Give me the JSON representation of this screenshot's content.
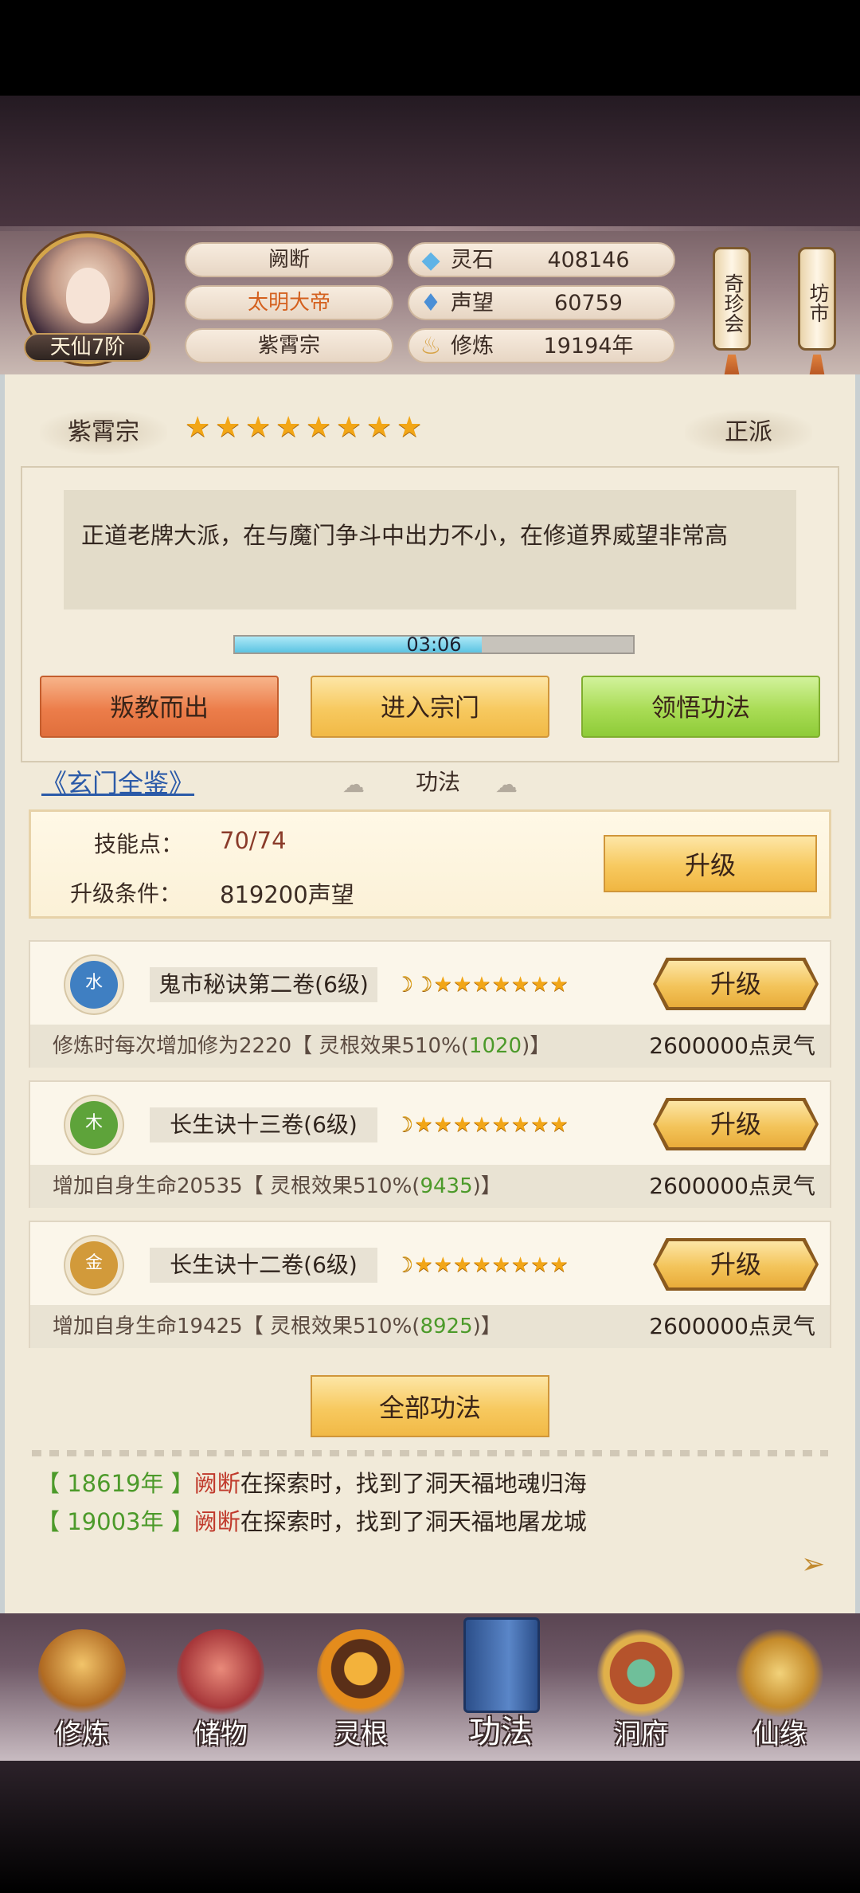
{
  "header": {
    "rank_badge": "天仙7阶",
    "player_name": "阙断",
    "title": "太明大帝",
    "sect": "紫霄宗",
    "stats": [
      {
        "icon": "spirit-stone-icon",
        "label": "灵石",
        "value": "408146"
      },
      {
        "icon": "reputation-icon",
        "label": "声望",
        "value": "60759"
      },
      {
        "icon": "cultivation-icon",
        "label": "修炼",
        "value": "19194年"
      }
    ],
    "side_buttons": [
      {
        "label": "奇珍会"
      },
      {
        "label": "坊市"
      }
    ]
  },
  "sect_panel": {
    "name": "紫霄宗",
    "stars": 8,
    "faction": "正派",
    "description": "正道老牌大派，在与魔门争斗中出力不小，在修道界威望非常高",
    "timer": "03:06",
    "timer_progress": 0.62,
    "buttons": {
      "betray": "叛教而出",
      "enter": "进入宗门",
      "comprehend": "领悟功法"
    }
  },
  "techniques": {
    "tome_link": "《玄门全鉴》",
    "tab_label": "功法",
    "skill_points_label": "技能点：",
    "skill_points_value": "70/74",
    "upgrade_cond_label": "升级条件：",
    "upgrade_cond_value": "819200声望",
    "upgrade_button": "升级",
    "list": [
      {
        "element": "水",
        "element_color": "#3f7fc2",
        "name": "鬼市秘诀第二卷(6级)",
        "moons": 2,
        "stars": 7,
        "desc_prefix": "修炼时每次增加修为2220【 灵根效果510%(",
        "desc_green": "1020",
        "desc_suffix": ")】",
        "cost": "2600000点灵气",
        "button": "升级"
      },
      {
        "element": "木",
        "element_color": "#5ea33a",
        "name": "长生诀十三卷(6级)",
        "moons": 1,
        "stars": 8,
        "desc_prefix": "增加自身生命20535【 灵根效果510%(",
        "desc_green": "9435",
        "desc_suffix": ")】",
        "cost": "2600000点灵气",
        "button": "升级"
      },
      {
        "element": "金",
        "element_color": "#d29a3a",
        "name": "长生诀十二卷(6级)",
        "moons": 1,
        "stars": 8,
        "desc_prefix": "增加自身生命19425【 灵根效果510%(",
        "desc_green": "8925",
        "desc_suffix": ")】",
        "cost": "2600000点灵气",
        "button": "升级"
      }
    ],
    "all_button": "全部功法"
  },
  "log": [
    {
      "year": "【 18619年 】",
      "name": "阙断",
      "text": "在探索时，找到了洞天福地魂归海"
    },
    {
      "year": "【 19003年 】",
      "name": "阙断",
      "text": "在探索时，找到了洞天福地屠龙城"
    }
  ],
  "bottom_nav": [
    {
      "label": "修炼",
      "icon": "cultivate-icon"
    },
    {
      "label": "储物",
      "icon": "storage-bag-icon"
    },
    {
      "label": "灵根",
      "icon": "spirit-root-icon"
    },
    {
      "label": "功法",
      "icon": "technique-book-icon",
      "active": true
    },
    {
      "label": "洞府",
      "icon": "cave-dwelling-icon"
    },
    {
      "label": "仙缘",
      "icon": "immortal-fate-icon"
    }
  ],
  "colors": {
    "title_orange": "#d4601e",
    "green": "#4c9a2a",
    "red_name": "#c0392b",
    "link_blue": "#2b5aa8"
  }
}
